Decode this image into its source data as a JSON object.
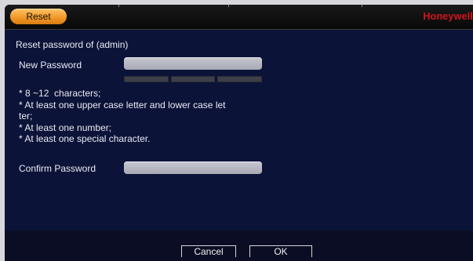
{
  "titlebar": {
    "tab_label": "Reset",
    "brand": "Honeywell"
  },
  "form": {
    "heading": "Reset password of (admin)",
    "new_password_label": "New Password",
    "new_password_value": "",
    "strength_segments": 3,
    "rules": [
      "* 8 ~12  characters;",
      "* At least one upper case letter and lower case let",
      "ter;",
      "* At least one number;",
      "* At least one special character."
    ],
    "confirm_password_label": "Confirm Password",
    "confirm_password_value": ""
  },
  "buttons": {
    "cancel": "Cancel",
    "ok": "OK"
  },
  "colors": {
    "window_bg": "#0c1338",
    "tab_accent": "#f29a28",
    "brand_red": "#d6141c"
  }
}
